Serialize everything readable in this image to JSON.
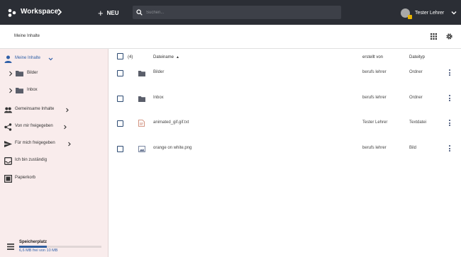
{
  "topbar": {
    "app_title": "Workspace",
    "new_label": "NEU",
    "search_placeholder": "Suchen...",
    "user_name": "Tester Lehrer"
  },
  "subheader": {
    "title": "Meine Inhalte"
  },
  "sidebar": {
    "items": [
      {
        "label": "Meine Inhalte",
        "icon": "person-icon"
      },
      {
        "label": "Gemeinsame Inhalte",
        "icon": "group-icon"
      },
      {
        "label": "Von mir freigegeben",
        "icon": "share-icon"
      },
      {
        "label": "Für mich freigegeben",
        "icon": "send-icon"
      },
      {
        "label": "Ich bin zuständig",
        "icon": "inbox-icon"
      },
      {
        "label": "Papierkorb",
        "icon": "trash-icon"
      }
    ],
    "subitems": [
      {
        "label": "Bilder"
      },
      {
        "label": "Inbox"
      }
    ],
    "storage": {
      "title": "Speicherplatz",
      "text": "6,6 MB frei von 10 MB",
      "fill_fraction": 0.34
    }
  },
  "table": {
    "count_label": "(4)",
    "headers": {
      "name": "Dateiname",
      "created_by": "erstellt von",
      "type": "Dateityp"
    },
    "rows": [
      {
        "name": "Bilder",
        "created_by": "berufs lehrer",
        "type": "Ordner",
        "icon": "folder-icon"
      },
      {
        "name": "Inbox",
        "created_by": "berufs lehrer",
        "type": "Ordner",
        "icon": "folder-icon"
      },
      {
        "name": "animated_gif.gif.txt",
        "created_by": "Tester Lehrer",
        "type": "Textdatei",
        "icon": "text-file-icon"
      },
      {
        "name": "orange on white.png",
        "created_by": "berufs lehrer",
        "type": "Bild",
        "icon": "image-file-icon"
      }
    ]
  },
  "colors": {
    "topbar": "#2b2e35",
    "sidebar": "#f9ecec",
    "accent": "#3060a8"
  }
}
